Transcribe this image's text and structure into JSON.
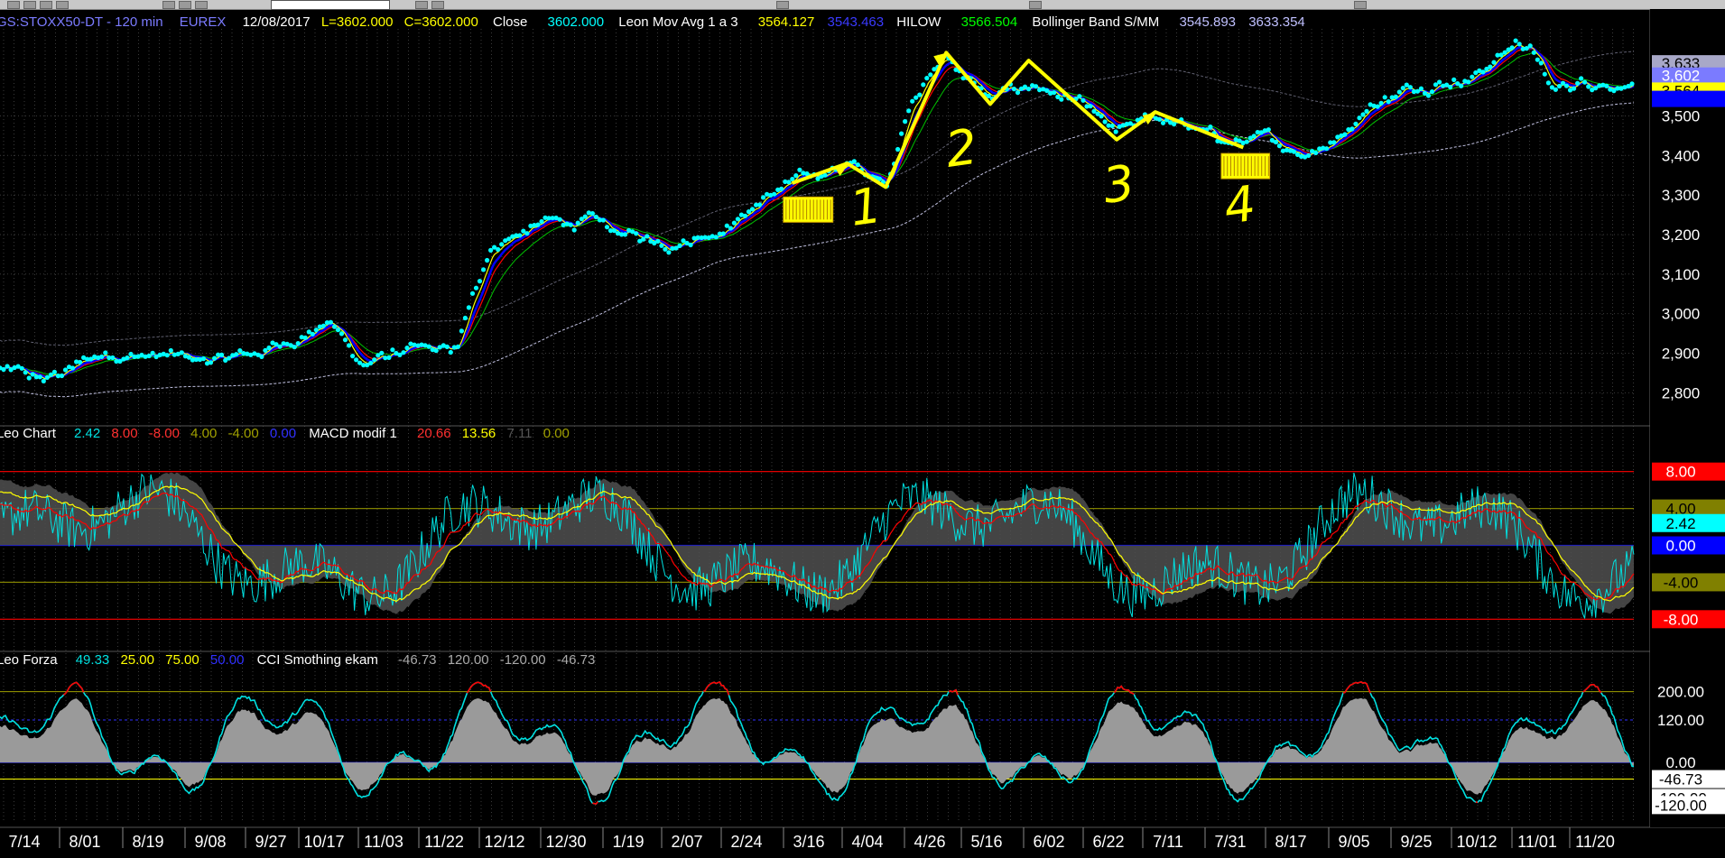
{
  "chart_data": [
    {
      "type": "line",
      "panel": "price",
      "symbol": "GS:STOXX50-DT",
      "interval": "120 min",
      "exchange": "EUREX",
      "date": "12/08/2017",
      "last": "L=3602.000",
      "close_text": "C=3602.000",
      "close_label": "Close",
      "close_value": "3602.000",
      "movavg_name": "Leon Mov Avg 1 a 3",
      "movavg_v1": "3564.127",
      "movavg_v2": "3543.463",
      "hilow_name": "HILOW",
      "hilow_value": "3566.504",
      "bollinger_name": "Bollinger Band S/MM",
      "bollinger_v1": "3545.893",
      "bollinger_v2": "3633.354",
      "ylim": [
        2730,
        3720
      ],
      "yticks": [
        "2,800",
        "2,900",
        "3,000",
        "3,100",
        "3,200",
        "3,300",
        "3,400",
        "3,500"
      ],
      "price_tags": [
        {
          "label": "3,633",
          "value": 3633,
          "bg": "#a8a8c8",
          "fg": "#000000"
        },
        {
          "label": "3,602",
          "value": 3602,
          "bg": "#7b7bff",
          "fg": "#ffffff"
        },
        {
          "label": "3,564",
          "value": 3564,
          "bg": "#ffff00",
          "fg": "#000000"
        },
        {
          "label": "",
          "value": 3543,
          "bg": "#0000ff",
          "fg": "#ffffff"
        }
      ],
      "anchors": [
        [
          0,
          2860
        ],
        [
          40,
          2830
        ],
        [
          95,
          2900
        ],
        [
          160,
          2890
        ],
        [
          195,
          2880
        ],
        [
          225,
          2895
        ],
        [
          255,
          2920
        ],
        [
          300,
          2980
        ],
        [
          330,
          2870
        ],
        [
          365,
          2905
        ],
        [
          415,
          2905
        ],
        [
          445,
          3170
        ],
        [
          495,
          3230
        ],
        [
          540,
          3230
        ],
        [
          565,
          3200
        ],
        [
          610,
          3180
        ],
        [
          660,
          3220
        ],
        [
          700,
          3300
        ],
        [
          720,
          3330
        ],
        [
          770,
          3380
        ],
        [
          805,
          3320
        ],
        [
          830,
          3560
        ],
        [
          860,
          3650
        ],
        [
          900,
          3540
        ],
        [
          940,
          3580
        ],
        [
          985,
          3520
        ],
        [
          1015,
          3450
        ],
        [
          1050,
          3500
        ],
        [
          1090,
          3460
        ],
        [
          1120,
          3430
        ],
        [
          1150,
          3440
        ],
        [
          1185,
          3410
        ],
        [
          1215,
          3440
        ],
        [
          1240,
          3520
        ],
        [
          1290,
          3580
        ],
        [
          1340,
          3600
        ],
        [
          1380,
          3690
        ],
        [
          1395,
          3660
        ],
        [
          1410,
          3560
        ],
        [
          1440,
          3590
        ],
        [
          1485,
          3580
        ]
      ],
      "annotations": {
        "zigzag": [
          [
            720,
            3330
          ],
          [
            770,
            3380
          ],
          [
            805,
            3320
          ],
          [
            860,
            3660
          ],
          [
            900,
            3530
          ],
          [
            935,
            3640
          ],
          [
            1015,
            3440
          ],
          [
            1050,
            3510
          ],
          [
            1130,
            3420
          ]
        ],
        "numbers": [
          "1",
          "2",
          "3",
          "4"
        ],
        "boxes": [
          [
            712,
            3275,
            45,
            25
          ],
          [
            1110,
            3385,
            44,
            25
          ]
        ]
      }
    },
    {
      "type": "line",
      "panel": "oscillator",
      "title": "Leo Chart",
      "values_text": [
        "2.42",
        "8.00",
        "-8.00",
        "4.00",
        "-4.00",
        "0.00"
      ],
      "values_colors": [
        "#00e0e0",
        "#ff3030",
        "#ff3030",
        "#a0a000",
        "#a0a000",
        "#3030ff"
      ],
      "subtitle": "MACD modif 1",
      "macd_text": [
        "20.66",
        "13.56",
        "7.11",
        "0.00"
      ],
      "macd_colors": [
        "#ff3030",
        "#ffff00",
        "#555555",
        "#a0a000"
      ],
      "ylim": [
        -11,
        11
      ],
      "levels": [
        8,
        4,
        0,
        -4,
        -8
      ],
      "tags": [
        {
          "label": "8.00",
          "value": 8,
          "bg": "#ff0000",
          "fg": "#ffffff"
        },
        {
          "label": "4.00",
          "value": 4,
          "bg": "#808000",
          "fg": "#000000"
        },
        {
          "label": "2.42",
          "value": 2.42,
          "bg": "#00ffff",
          "fg": "#000000"
        },
        {
          "label": "0.00",
          "value": 0,
          "bg": "#0000ff",
          "fg": "#ffffff"
        },
        {
          "label": "-4.00",
          "value": -4,
          "bg": "#808000",
          "fg": "#000000"
        },
        {
          "label": "-8.00",
          "value": -8,
          "bg": "#ff0000",
          "fg": "#ffffff"
        }
      ]
    },
    {
      "type": "area",
      "panel": "cci",
      "title": "Leo Forza",
      "values_text": [
        "49.33",
        "25.00",
        "75.00",
        "50.00"
      ],
      "values_colors": [
        "#00e0e0",
        "#ffff00",
        "#ffff00",
        "#3030ff"
      ],
      "subtitle": "CCI Smothing ekam",
      "cci_text": [
        "-46.73",
        "120.00",
        "-120.00",
        "-46.73"
      ],
      "cci_colors": [
        "#aaaaaa",
        "#aaaaaa",
        "#aaaaaa",
        "#aaaaaa"
      ],
      "ylim": [
        -170,
        260
      ],
      "levels": [
        200,
        120,
        0,
        -46.73
      ],
      "yticks": [
        "200.00",
        "120.00",
        "0.00"
      ],
      "tags": [
        {
          "label": "-46.73",
          "value": -46.73,
          "bg": "#ffffff",
          "fg": "#000000"
        },
        {
          "label": "-100.00",
          "value": -100,
          "bg": "#ffffff",
          "fg": "#000000"
        },
        {
          "label": "-120.00",
          "value": -120,
          "bg": "#ffffff",
          "fg": "#000000"
        }
      ]
    }
  ],
  "x_axis": {
    "labels": [
      "7/14",
      "8/01",
      "8/19",
      "9/08",
      "9/27",
      "10/17",
      "11/03",
      "11/22",
      "12/12",
      "12/30",
      "1/19",
      "2/07",
      "2/24",
      "3/16",
      "4/04",
      "4/26",
      "5/16",
      "6/02",
      "6/22",
      "7/11",
      "7/31",
      "8/17",
      "9/05",
      "9/25",
      "10/12",
      "11/01",
      "11/20"
    ],
    "positions": [
      27,
      94,
      164,
      233,
      300,
      359,
      425,
      492,
      559,
      627,
      696,
      761,
      827,
      896,
      961,
      1030,
      1093,
      1162,
      1228,
      1294,
      1363,
      1430,
      1500,
      1569,
      1636,
      1703,
      1767
    ]
  },
  "colors": {
    "price_dots": "#00ffff",
    "ma_red": "#ff0000",
    "ma_blue": "#0000ff",
    "ma_green": "#00c000",
    "ma_yellow": "#ffff00",
    "bollinger": "#c0c0e0",
    "osc_cyan": "#00e0e0",
    "cci_red": "#ff0000"
  }
}
